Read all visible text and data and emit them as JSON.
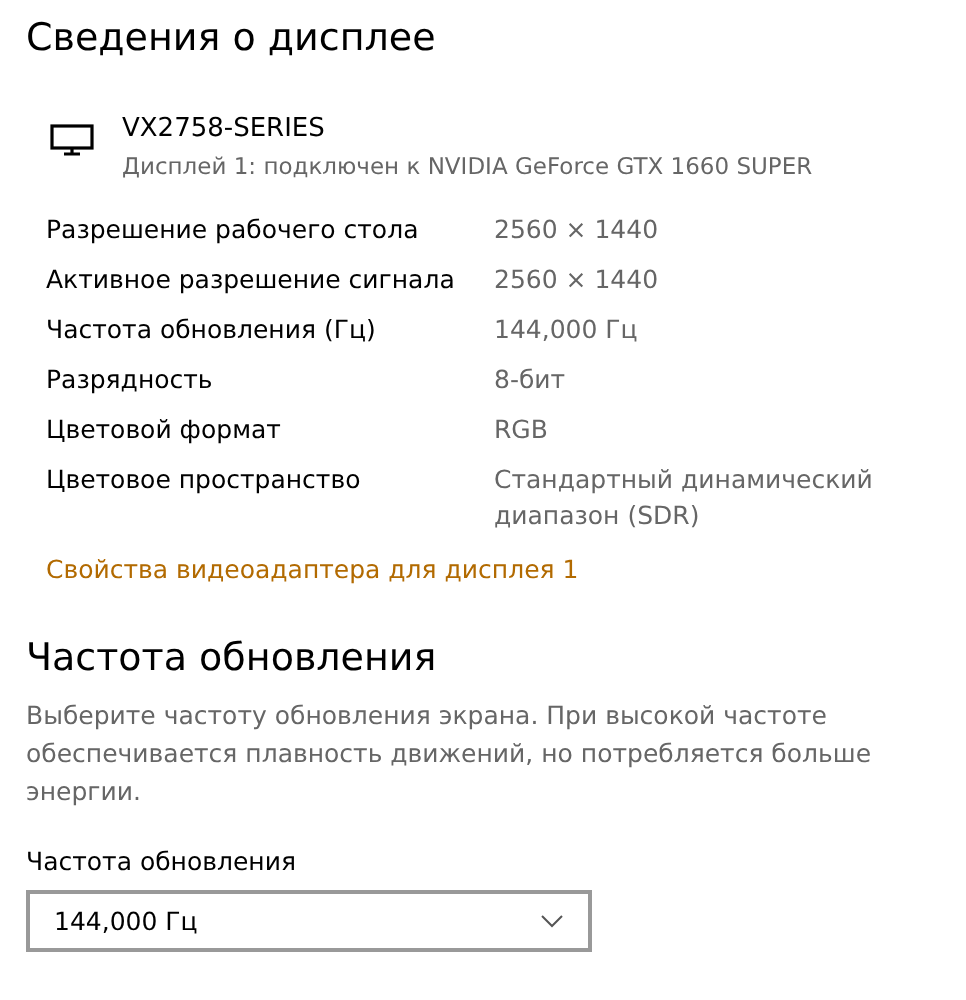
{
  "title": "Сведения о дисплее",
  "display": {
    "name": "VX2758-SERIES",
    "subtitle": "Дисплей 1: подключен к NVIDIA GeForce GTX 1660 SUPER"
  },
  "properties": [
    {
      "label": "Разрешение рабочего стола",
      "value": "2560 × 1440"
    },
    {
      "label": "Активное разрешение сигнала",
      "value": "2560 × 1440"
    },
    {
      "label": "Частота обновления (Гц)",
      "value": "144,000 Гц"
    },
    {
      "label": "Разрядность",
      "value": "8-бит"
    },
    {
      "label": "Цветовой формат",
      "value": "RGB"
    },
    {
      "label": "Цветовое пространство",
      "value": "Стандартный динамический диапазон (SDR)"
    }
  ],
  "adapter_link": "Свойства видеоадаптера для дисплея 1",
  "refresh_section": {
    "heading": "Частота обновления",
    "description": "Выберите частоту обновления экрана. При высокой частоте обеспечивается плавность движений, но потребляется больше энергии.",
    "dropdown_label": "Частота обновления",
    "dropdown_value": "144,000 Гц"
  }
}
